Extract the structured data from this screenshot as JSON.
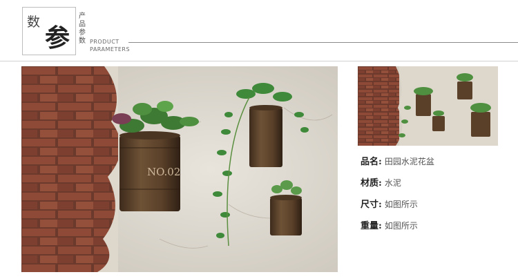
{
  "header": {
    "logo_char1": "数",
    "logo_char2": "参",
    "vertical_chars": [
      "产",
      "品",
      "参",
      "数"
    ],
    "en_line1": "PRODUCT",
    "en_line2": "PARAMETERS"
  },
  "specs": [
    {
      "label": "品名:",
      "value": "田园水泥花盆"
    },
    {
      "label": "材质:",
      "value": "水泥"
    },
    {
      "label": "尺寸:",
      "value": "如图所示"
    },
    {
      "label": "重量:",
      "value": "如图所示"
    }
  ],
  "pot_label": "NO.02"
}
